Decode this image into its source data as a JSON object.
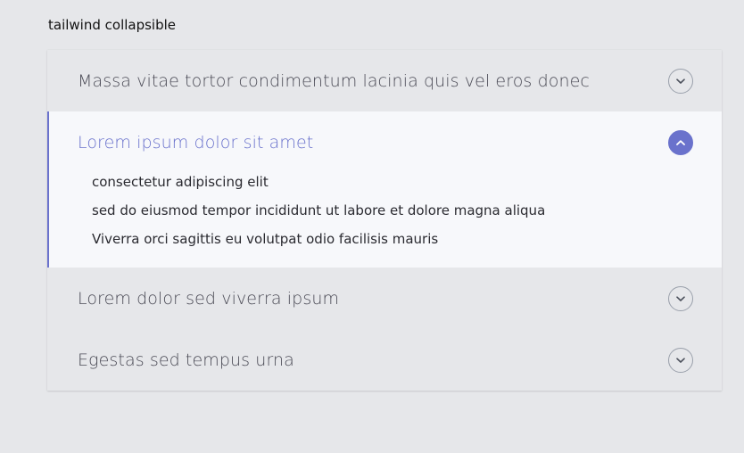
{
  "page": {
    "title": "tailwind collapsible"
  },
  "accordion": {
    "accent_color": "#6a72cc",
    "items": [
      {
        "title": "Massa vitae tortor condimentum lacinia quis vel eros donec",
        "expanded": false,
        "toggle_icon": "chevron-down-icon"
      },
      {
        "title": "Lorem ipsum dolor sit amet",
        "expanded": true,
        "toggle_icon": "chevron-up-icon",
        "lines": [
          "consectetur adipiscing elit",
          "sed do eiusmod tempor incididunt ut labore et dolore magna aliqua",
          "Viverra orci sagittis eu volutpat odio facilisis mauris"
        ]
      },
      {
        "title": "Lorem dolor sed viverra ipsum",
        "expanded": false,
        "toggle_icon": "chevron-down-icon"
      },
      {
        "title": "Egestas sed tempus urna",
        "expanded": false,
        "toggle_icon": "chevron-down-icon"
      }
    ]
  }
}
